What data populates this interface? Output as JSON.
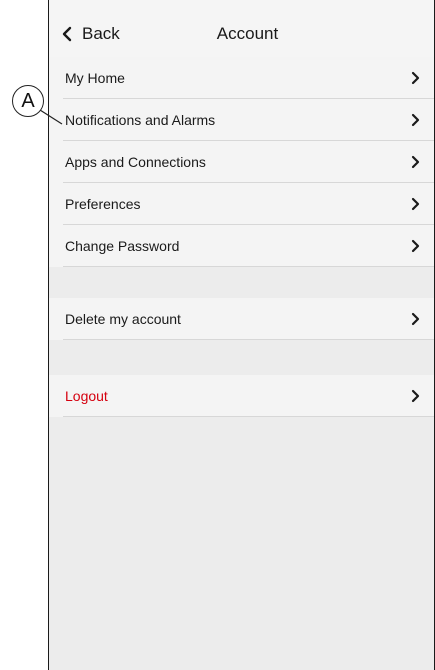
{
  "annotation": {
    "label": "A"
  },
  "header": {
    "back_label": "Back",
    "title": "Account"
  },
  "menu": {
    "items": [
      {
        "label": "My Home"
      },
      {
        "label": "Notifications and Alarms"
      },
      {
        "label": "Apps and Connections"
      },
      {
        "label": "Preferences"
      },
      {
        "label": "Change Password"
      }
    ],
    "delete_label": "Delete my account",
    "logout_label": "Logout"
  },
  "colors": {
    "logout_text": "#d5000f",
    "background": "#ececec",
    "row_background": "#f4f4f4"
  }
}
